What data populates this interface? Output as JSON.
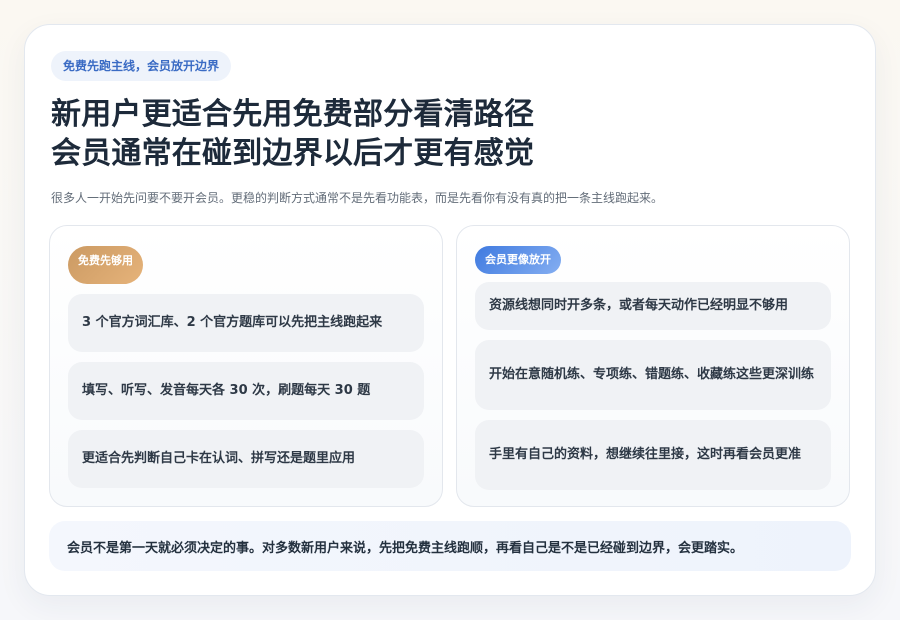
{
  "header": {
    "badge": "免费先跑主线，会员放开边界",
    "title_line1": "新用户更适合先用免费部分看清路径",
    "title_line2": "会员通常在碰到边界以后才更有感觉",
    "subtitle": "很多人一开始先问要不要开会员。更稳的判断方式通常不是先看功能表，而是先看你有没有真的把一条主线跑起来。"
  },
  "left_panel": {
    "tag": "免费先够用",
    "items": [
      "3 个官方词汇库、2 个官方题库可以先把主线跑起来",
      "填写、听写、发音每天各 30 次，刷题每天 30 题",
      "更适合先判断自己卡在认词、拼写还是题里应用"
    ]
  },
  "right_panel": {
    "tag": "会员更像放开",
    "items": [
      "资源线想同时开多条，或者每天动作已经明显不够用",
      "开始在意随机练、专项练、错题练、收藏练这些更深训练",
      "手里有自己的资料，想继续往里接，这时再看会员更准"
    ]
  },
  "footer": {
    "text": "会员不是第一天就必须决定的事。对多数新用户来说，先把免费主线跑顺，再看自己是不是已经碰到边界，会更踏实。"
  },
  "colors": {
    "title": "#1d2a3a",
    "badge_text": "#3a6bc4",
    "orange_tag": "#cb9a63",
    "blue_tag": "#3f7ae0"
  }
}
